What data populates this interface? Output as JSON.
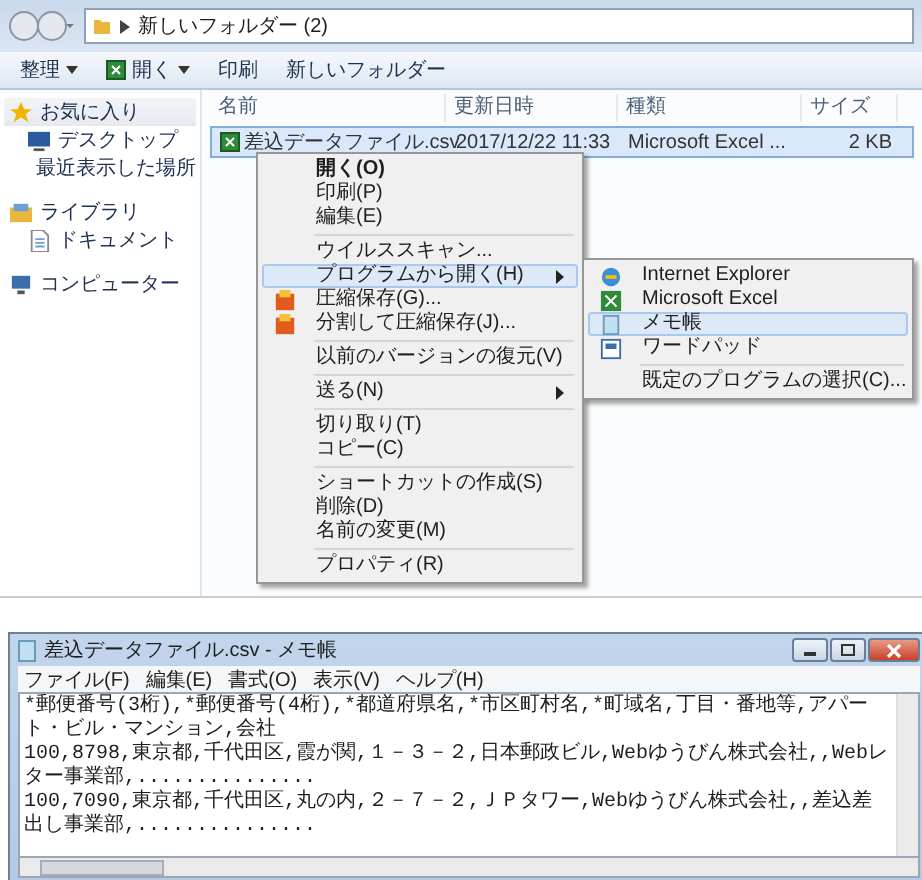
{
  "address": {
    "path": "新しいフォルダー (2)"
  },
  "toolbar": [
    {
      "label": "整理",
      "dropdown": true,
      "kind": "plain"
    },
    {
      "label": "開く",
      "dropdown": true,
      "kind": "app"
    },
    {
      "label": "印刷",
      "dropdown": false,
      "kind": "plain"
    },
    {
      "label": "新しいフォルダー",
      "dropdown": false,
      "kind": "plain"
    }
  ],
  "sidebar": {
    "items": [
      {
        "label": "お気に入り",
        "kind": "star",
        "selected": true,
        "children": [
          {
            "label": "デスクトップ",
            "kind": "desktop",
            "selected": false
          },
          {
            "label": "最近表示した場所",
            "kind": "recent",
            "selected": false
          }
        ]
      },
      {
        "label": "ライブラリ",
        "kind": "library",
        "selected": false,
        "children": [
          {
            "label": "ドキュメント",
            "kind": "document",
            "selected": false
          }
        ]
      },
      {
        "label": "コンピューター",
        "kind": "computer",
        "selected": false
      }
    ]
  },
  "table": {
    "columns": [
      "名前",
      "更新日時",
      "種類",
      "サイズ"
    ],
    "rows": [
      {
        "name": "差込データファイル.csv",
        "modified": "2017/12/22 11:33",
        "type": "Microsoft Excel ...",
        "size": "2 KB",
        "selected": true
      }
    ]
  },
  "context_menu": {
    "items": [
      {
        "kind": "item",
        "label": "開く(O)",
        "bold": true,
        "selected": false,
        "submenu": false
      },
      {
        "kind": "item",
        "label": "印刷(P)",
        "bold": false,
        "selected": false,
        "submenu": false
      },
      {
        "kind": "item",
        "label": "編集(E)",
        "bold": false,
        "selected": false,
        "submenu": false
      },
      {
        "kind": "separator"
      },
      {
        "kind": "item",
        "label": "ウイルススキャン...",
        "bold": false,
        "selected": false,
        "submenu": false
      },
      {
        "kind": "item",
        "label": "プログラムから開く(H)",
        "bold": false,
        "selected": true,
        "submenu": true
      },
      {
        "kind": "archive",
        "label": "圧縮保存(G)...",
        "bold": false,
        "selected": false,
        "submenu": false
      },
      {
        "kind": "archive",
        "label": "分割して圧縮保存(J)...",
        "bold": false,
        "selected": false,
        "submenu": false
      },
      {
        "kind": "separator"
      },
      {
        "kind": "item",
        "label": "以前のバージョンの復元(V)",
        "bold": false,
        "selected": false,
        "submenu": false
      },
      {
        "kind": "separator"
      },
      {
        "kind": "item",
        "label": "送る(N)",
        "bold": false,
        "selected": false,
        "submenu": true
      },
      {
        "kind": "separator"
      },
      {
        "kind": "item",
        "label": "切り取り(T)",
        "bold": false,
        "selected": false,
        "submenu": false
      },
      {
        "kind": "item",
        "label": "コピー(C)",
        "bold": false,
        "selected": false,
        "submenu": false
      },
      {
        "kind": "separator"
      },
      {
        "kind": "item",
        "label": "ショートカットの作成(S)",
        "bold": false,
        "selected": false,
        "submenu": false
      },
      {
        "kind": "item",
        "label": "削除(D)",
        "bold": false,
        "selected": false,
        "submenu": false
      },
      {
        "kind": "item",
        "label": "名前の変更(M)",
        "bold": false,
        "selected": false,
        "submenu": false
      },
      {
        "kind": "separator"
      },
      {
        "kind": "item",
        "label": "プロパティ(R)",
        "bold": false,
        "selected": false,
        "submenu": false
      }
    ]
  },
  "open_with_menu": {
    "items": [
      {
        "kind": "browser",
        "label": "Internet Explorer",
        "selected": false
      },
      {
        "kind": "excel",
        "label": "Microsoft Excel",
        "selected": false
      },
      {
        "kind": "notepad",
        "label": "メモ帳",
        "selected": true
      },
      {
        "kind": "wordpad",
        "label": "ワードパッド",
        "selected": false
      },
      {
        "kind": "separator"
      },
      {
        "kind": "item",
        "label": "既定のプログラムの選択(C)...",
        "selected": false
      }
    ]
  },
  "notepad": {
    "title": "差込データファイル.csv - メモ帳",
    "menu": [
      "ファイル(F)",
      "編集(E)",
      "書式(O)",
      "表示(V)",
      "ヘルプ(H)"
    ],
    "lines": [
      "*郵便番号(3桁),*郵便番号(4桁),*都道府県名,*市区町村名,*町域名,丁目・番地等,アパート・ビル・マンション,会社",
      "100,8798,東京都,千代田区,霞が関,１－３－２,日本郵政ビル,Webゆうびん株式会社,,Webレター事業部,...............",
      "100,7090,東京都,千代田区,丸の内,２－７－２,ＪＰタワー,Webゆうびん株式会社,,差込差出し事業部,..............."
    ]
  }
}
